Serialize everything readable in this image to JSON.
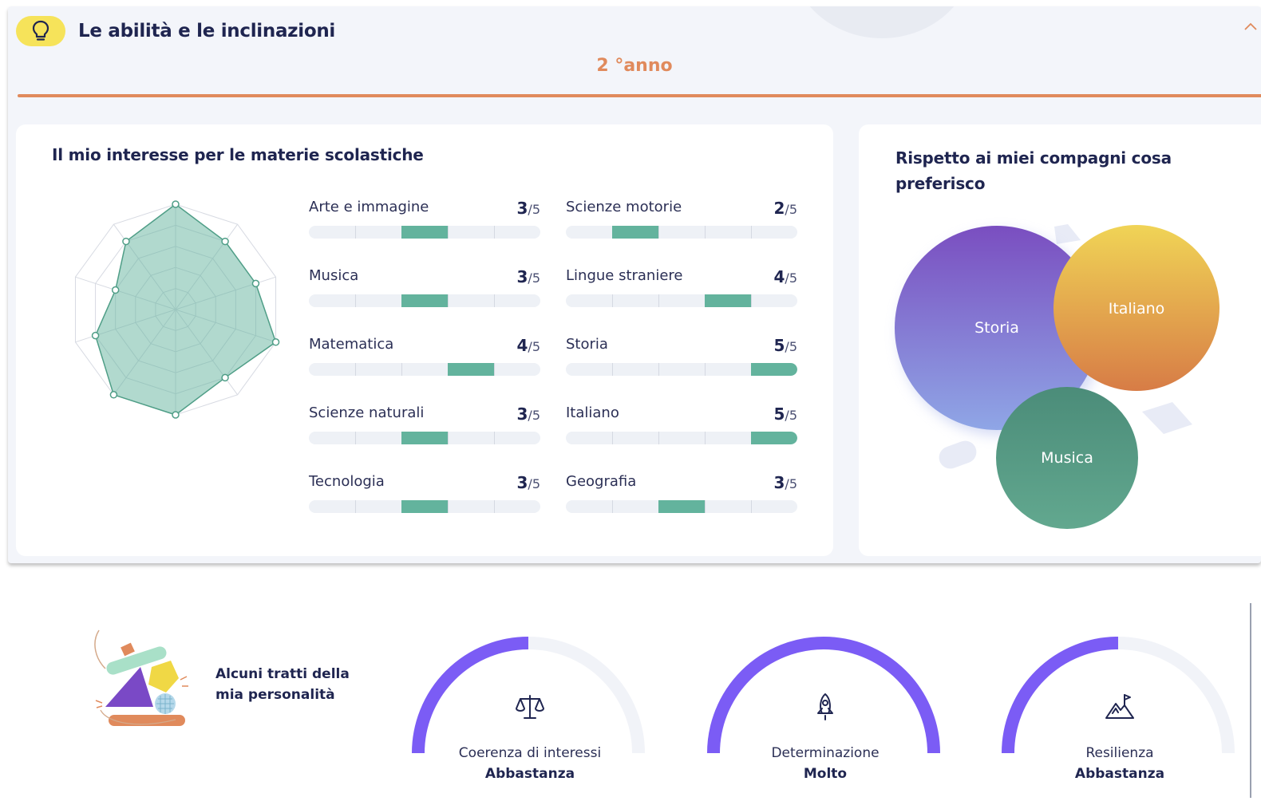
{
  "section": {
    "title": "Le abilità e le inclinazioni",
    "year_label": "2 °anno",
    "icons": {
      "bulb": "lightbulb-icon",
      "collapse": "chevron-up-icon"
    }
  },
  "interests": {
    "title": "Il mio interesse per le materie scolastiche",
    "max": 5,
    "denominator": "/5",
    "subjects": [
      {
        "name": "Arte e immagine",
        "score": 3
      },
      {
        "name": "Scienze motorie",
        "score": 2
      },
      {
        "name": "Musica",
        "score": 3
      },
      {
        "name": "Lingue straniere",
        "score": 4
      },
      {
        "name": "Matematica",
        "score": 4
      },
      {
        "name": "Storia",
        "score": 5
      },
      {
        "name": "Scienze naturali",
        "score": 3
      },
      {
        "name": "Italiano",
        "score": 5
      },
      {
        "name": "Tecnologia",
        "score": 3
      },
      {
        "name": "Geografia",
        "score": 3
      }
    ],
    "radar_values": [
      5,
      4,
      4,
      5,
      4,
      5,
      5,
      4,
      3,
      4
    ],
    "colors": {
      "fill": "#63b39d",
      "track": "#eef1f6"
    }
  },
  "preferences": {
    "title": "Rispetto ai miei compagni cosa preferisco",
    "bubbles": [
      {
        "label": "Storia",
        "rank": 1,
        "color_top": "#7a4ec0",
        "color_bottom": "#8fa6e6"
      },
      {
        "label": "Italiano",
        "rank": 2,
        "color_top": "#f0d456",
        "color_bottom": "#d77c46"
      },
      {
        "label": "Musica",
        "rank": 3,
        "color_top": "#4b8c79",
        "color_bottom": "#62a88f"
      }
    ]
  },
  "personality": {
    "title": "Alcuni tratti della mia personalità",
    "traits": [
      {
        "label": "Coerenza di interessi",
        "value": "Abbastanza",
        "level": 0.5,
        "icon": "balance-scale-icon"
      },
      {
        "label": "Determinazione",
        "value": "Molto",
        "level": 1.0,
        "icon": "rocket-icon"
      },
      {
        "label": "Resilienza",
        "value": "Abbastanza",
        "level": 0.5,
        "icon": "mountain-flag-icon"
      }
    ],
    "colors": {
      "arc": "#7b5cf5",
      "track": "#f1f3f8"
    }
  }
}
